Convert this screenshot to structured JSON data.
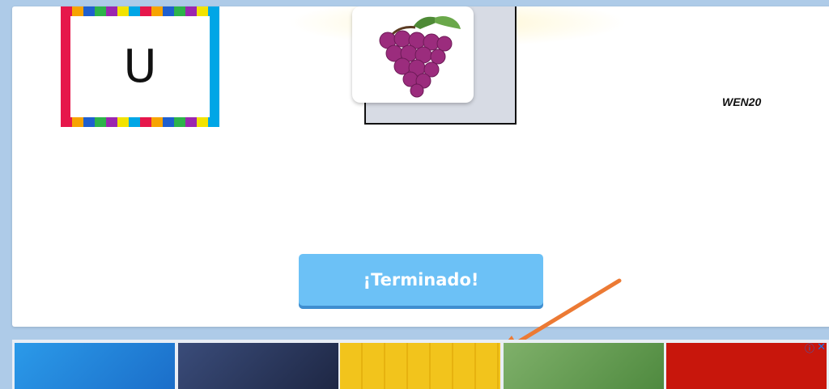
{
  "activity": {
    "letter": "U",
    "code": "WEN20",
    "done_button": "¡Terminado!"
  },
  "icons": {
    "fruit": "grapes-icon",
    "ad_info": "info-icon",
    "ad_close": "close-icon",
    "pointer": "arrow-icon"
  },
  "ad_strip": {
    "info_symbol": "ⓘ",
    "close_symbol": "✕",
    "tiles": [
      "ad-thumbnail-1",
      "ad-thumbnail-2",
      "ad-thumbnail-3",
      "ad-thumbnail-4",
      "ad-thumbnail-5"
    ]
  },
  "colors": {
    "background": "#aecbe8",
    "button": "#6cc1f6",
    "arrow": "#ec7a34",
    "grapes": "#9b2c7d"
  }
}
